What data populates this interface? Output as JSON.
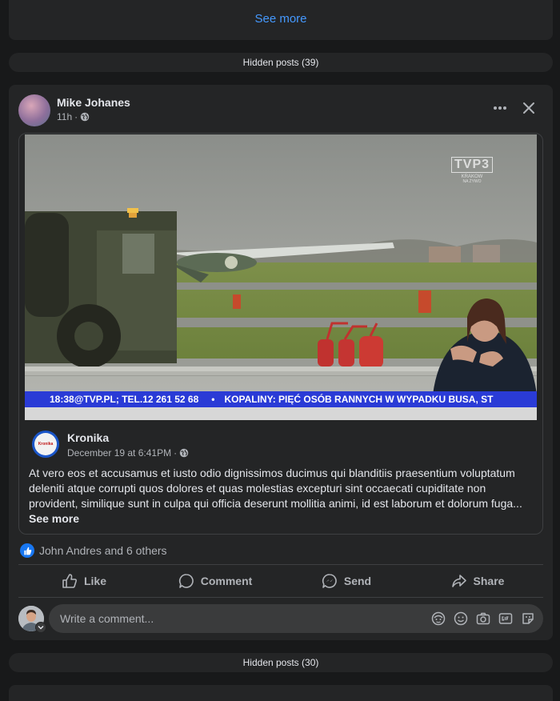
{
  "top_card": {
    "see_more": "See more"
  },
  "hidden_posts_1": "Hidden posts (39)",
  "hidden_posts_2": "Hidden posts (30)",
  "post": {
    "author": "Mike Johanes",
    "time": "11h",
    "shared": {
      "page_name": "Kronika",
      "avatar_text": "Kronika",
      "date": "December 19 at 6:41PM",
      "text": "At vero eos et accusamus et iusto odio dignissimos ducimus qui blanditiis praesentium voluptatum deleniti atque corrupti quos dolores et quas molestias excepturi sint occaecati cupiditate non provident, similique sunt in culpa qui officia deserunt mollitia animi, id est laborum et dolorum fuga...",
      "see_more": "See more",
      "video": {
        "channel_logo": "TVP3",
        "channel_sub1": "KRAKOW",
        "channel_sub2": "NA ŻYWO",
        "ticker_time": "18:38",
        "ticker_contact": "@TVP.PL; TEL.12 261 52 68",
        "ticker_bullet": "•",
        "ticker_headline": "KOPALINY: PIĘĆ OSÓB RANNYCH W WYPADKU BUSA, ST"
      }
    },
    "reactions": "John Andres and 6 others",
    "actions": {
      "like": "Like",
      "comment": "Comment",
      "send": "Send",
      "share": "Share"
    },
    "comment_placeholder": "Write a comment..."
  },
  "icons": {
    "more": "more-icon",
    "close": "close-icon",
    "globe": "globe-icon",
    "like": "like-icon",
    "comment": "comment-icon",
    "send": "messenger-icon",
    "share": "share-icon",
    "avatar_sticker": "avatar-sticker-icon",
    "emoji": "emoji-icon",
    "camera": "camera-icon",
    "gif": "gif-icon",
    "sticker": "sticker-icon"
  },
  "colors": {
    "background": "#18191a",
    "card": "#242526",
    "link": "#4599ff",
    "like_blue": "#1877f2",
    "ticker_blue": "#2a3bd6"
  }
}
